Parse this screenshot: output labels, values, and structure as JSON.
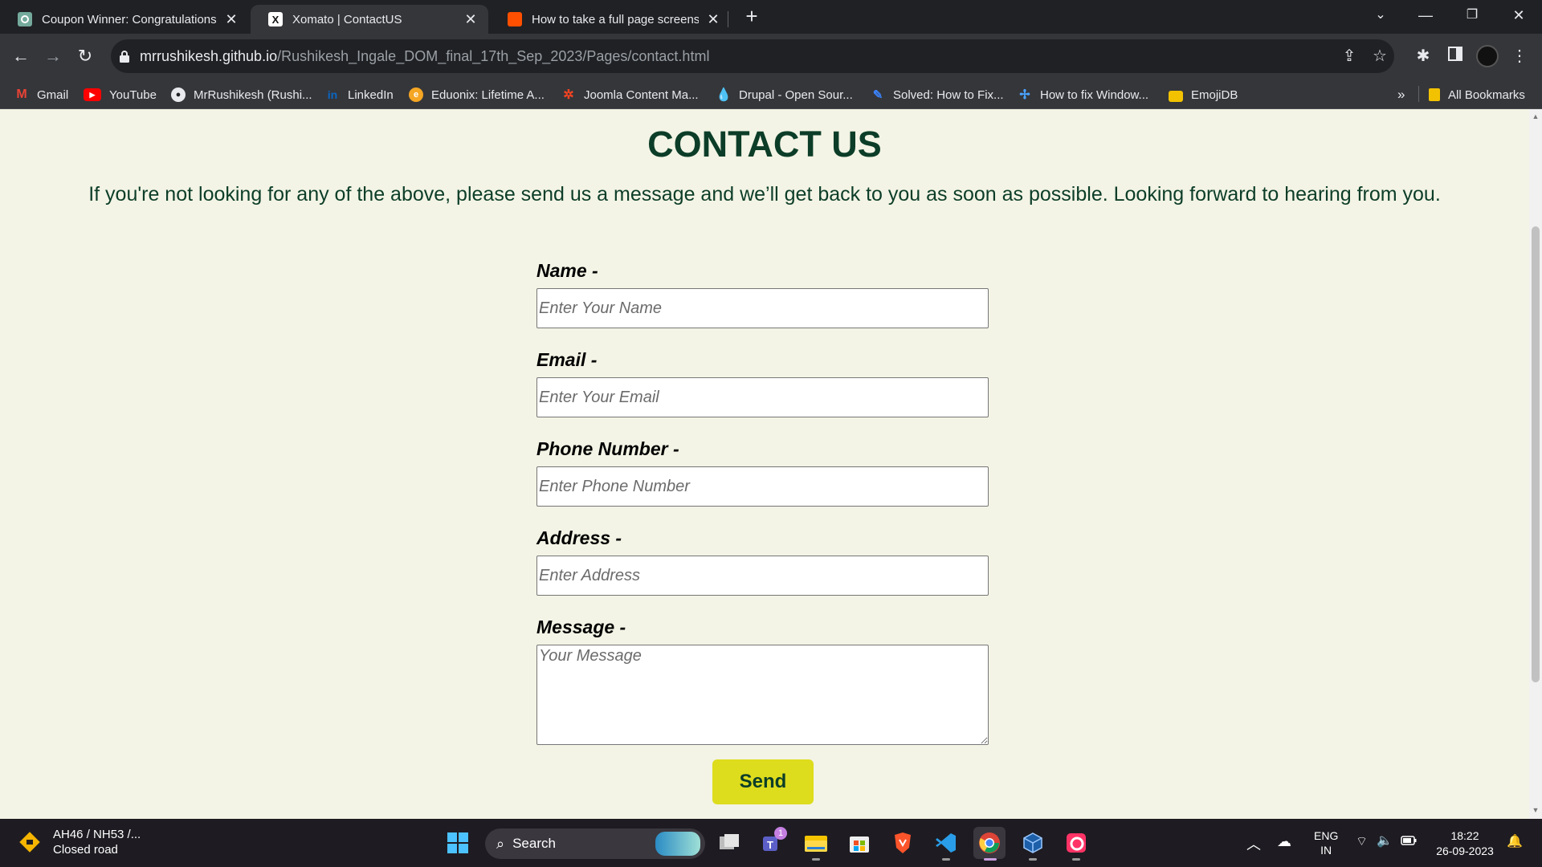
{
  "browser": {
    "tabs": [
      {
        "title": "Coupon Winner: Congratulations",
        "active": false,
        "favicon_color": "#74aa9c"
      },
      {
        "title": "Xomato | ContactUS",
        "active": true,
        "favicon_color": "#ffffff"
      },
      {
        "title": "How to take a full page screenshot",
        "active": false,
        "favicon_color": "#ff4f00"
      }
    ],
    "url_domain": "mrrushikesh.github.io",
    "url_path": "/Rushikesh_Ingale_DOM_final_17th_Sep_2023/Pages/contact.html",
    "bookmarks": [
      {
        "label": "Gmail",
        "icon": "gmail-icon"
      },
      {
        "label": "YouTube",
        "icon": "youtube-icon"
      },
      {
        "label": "MrRushikesh (Rushi...",
        "icon": "github-icon"
      },
      {
        "label": "LinkedIn",
        "icon": "linkedin-icon"
      },
      {
        "label": "Eduonix: Lifetime A...",
        "icon": "eduonix-icon"
      },
      {
        "label": "Joomla Content Ma...",
        "icon": "joomla-icon"
      },
      {
        "label": "Drupal - Open Sour...",
        "icon": "drupal-icon"
      },
      {
        "label": "Solved: How to Fix...",
        "icon": "solved-icon"
      },
      {
        "label": "How to fix Window...",
        "icon": "windows-fix-icon"
      },
      {
        "label": "EmojiDB",
        "icon": "folder-icon"
      }
    ],
    "bookmarks_overflow": "»",
    "all_bookmarks": "All Bookmarks"
  },
  "page": {
    "title": "CONTACT US",
    "lead": "If you're not looking for any of the above, please send us a message and we’ll get back to you as soon as possible. Looking forward to hearing from you.",
    "fields": {
      "name": {
        "label": "Name -",
        "placeholder": "Enter Your Name"
      },
      "email": {
        "label": "Email -",
        "placeholder": "Enter Your Email"
      },
      "phone": {
        "label": "Phone Number -",
        "placeholder": "Enter Phone Number"
      },
      "address": {
        "label": "Address -",
        "placeholder": "Enter Address"
      },
      "message": {
        "label": "Message -",
        "placeholder": "Your Message"
      }
    },
    "send_label": "Send",
    "colors": {
      "background": "#f3f4e5",
      "heading": "#0c3d28",
      "button": "#dddc1d"
    }
  },
  "taskbar": {
    "weather_line1": "AH46 / NH53 /...",
    "weather_line2": "Closed road",
    "search_label": "Search",
    "teams_badge": "1",
    "lang_line1": "ENG",
    "lang_line2": "IN",
    "time": "18:22",
    "date": "26-09-2023"
  }
}
